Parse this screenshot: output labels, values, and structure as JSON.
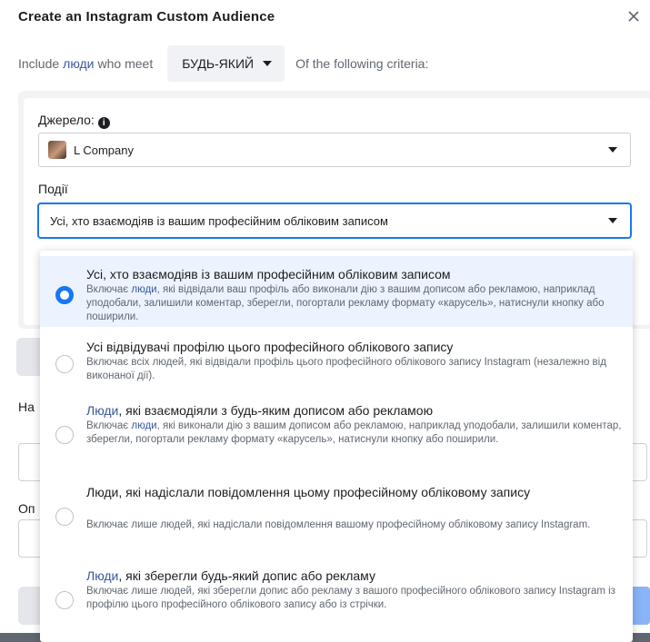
{
  "dialog": {
    "title": "Create an Instagram Custom Audience"
  },
  "include_row": {
    "prefix": "Include",
    "link": "люди",
    "middle": "who meet",
    "any_label": "БУДЬ-ЯКИЙ",
    "suffix": "Of the following criteria:"
  },
  "source": {
    "label": "Джерело:",
    "value": "L Company"
  },
  "events": {
    "label": "Події",
    "value": "Усі, хто взаємодіяв із вашим професійним обліковим записом"
  },
  "background": {
    "frag_na": "На",
    "frag_op": "Оп"
  },
  "dropdown": {
    "options": [
      {
        "title": "Усі, хто взаємодіяв із вашим професійним обліковим записом",
        "desc_pre": "Включає",
        "desc_link": "люди",
        "desc_post": ", які відвідали ваш профіль або виконали дію з вашим дописом або рекламою, наприклад уподобали, залишили коментар, зберегли, погортали рекламу формату «карусель», натиснули кнопку або поширили.",
        "selected": true
      },
      {
        "title": "Усі відвідувачі профілю цього професійного облікового запису",
        "desc": "Включає всіх людей, які відвідали профіль цього професійного облікового запису Instagram (незалежно від виконаної дії).",
        "selected": false
      },
      {
        "title_link": "Люди",
        "title_post": ", які взаємодіяли з будь-яким дописом або рекламою",
        "desc_pre": "Включає",
        "desc_link": "люди",
        "desc_post": ", які виконали дію з вашим дописом або рекламою, наприклад уподобали, залишили коментар, зберегли, погортали рекламу формату «карусель», натиснули кнопку або поширили.",
        "selected": false
      },
      {
        "title": "Люди, які надіслали повідомлення цьому професійному обліковому запису",
        "desc": "Включає лише людей, які надіслали повідомлення вашому професійному обліковому запису Instagram.",
        "selected": false
      },
      {
        "title_link": "Люди",
        "title_post": ", які зберегли будь-який допис або рекламу",
        "desc": "Включає лише людей, які зберегли допис або рекламу з вашого професійного облікового запису Instagram із профілю цього професійного облікового запису або із стрічки.",
        "selected": false
      }
    ]
  },
  "colors": {
    "accent": "#1877f2",
    "link": "#385898",
    "selected_bg": "#ecf3ff"
  },
  "icons": [
    "close-icon",
    "chevron-down-icon",
    "info-icon",
    "radio-selected-icon",
    "radio-unselected-icon"
  ]
}
